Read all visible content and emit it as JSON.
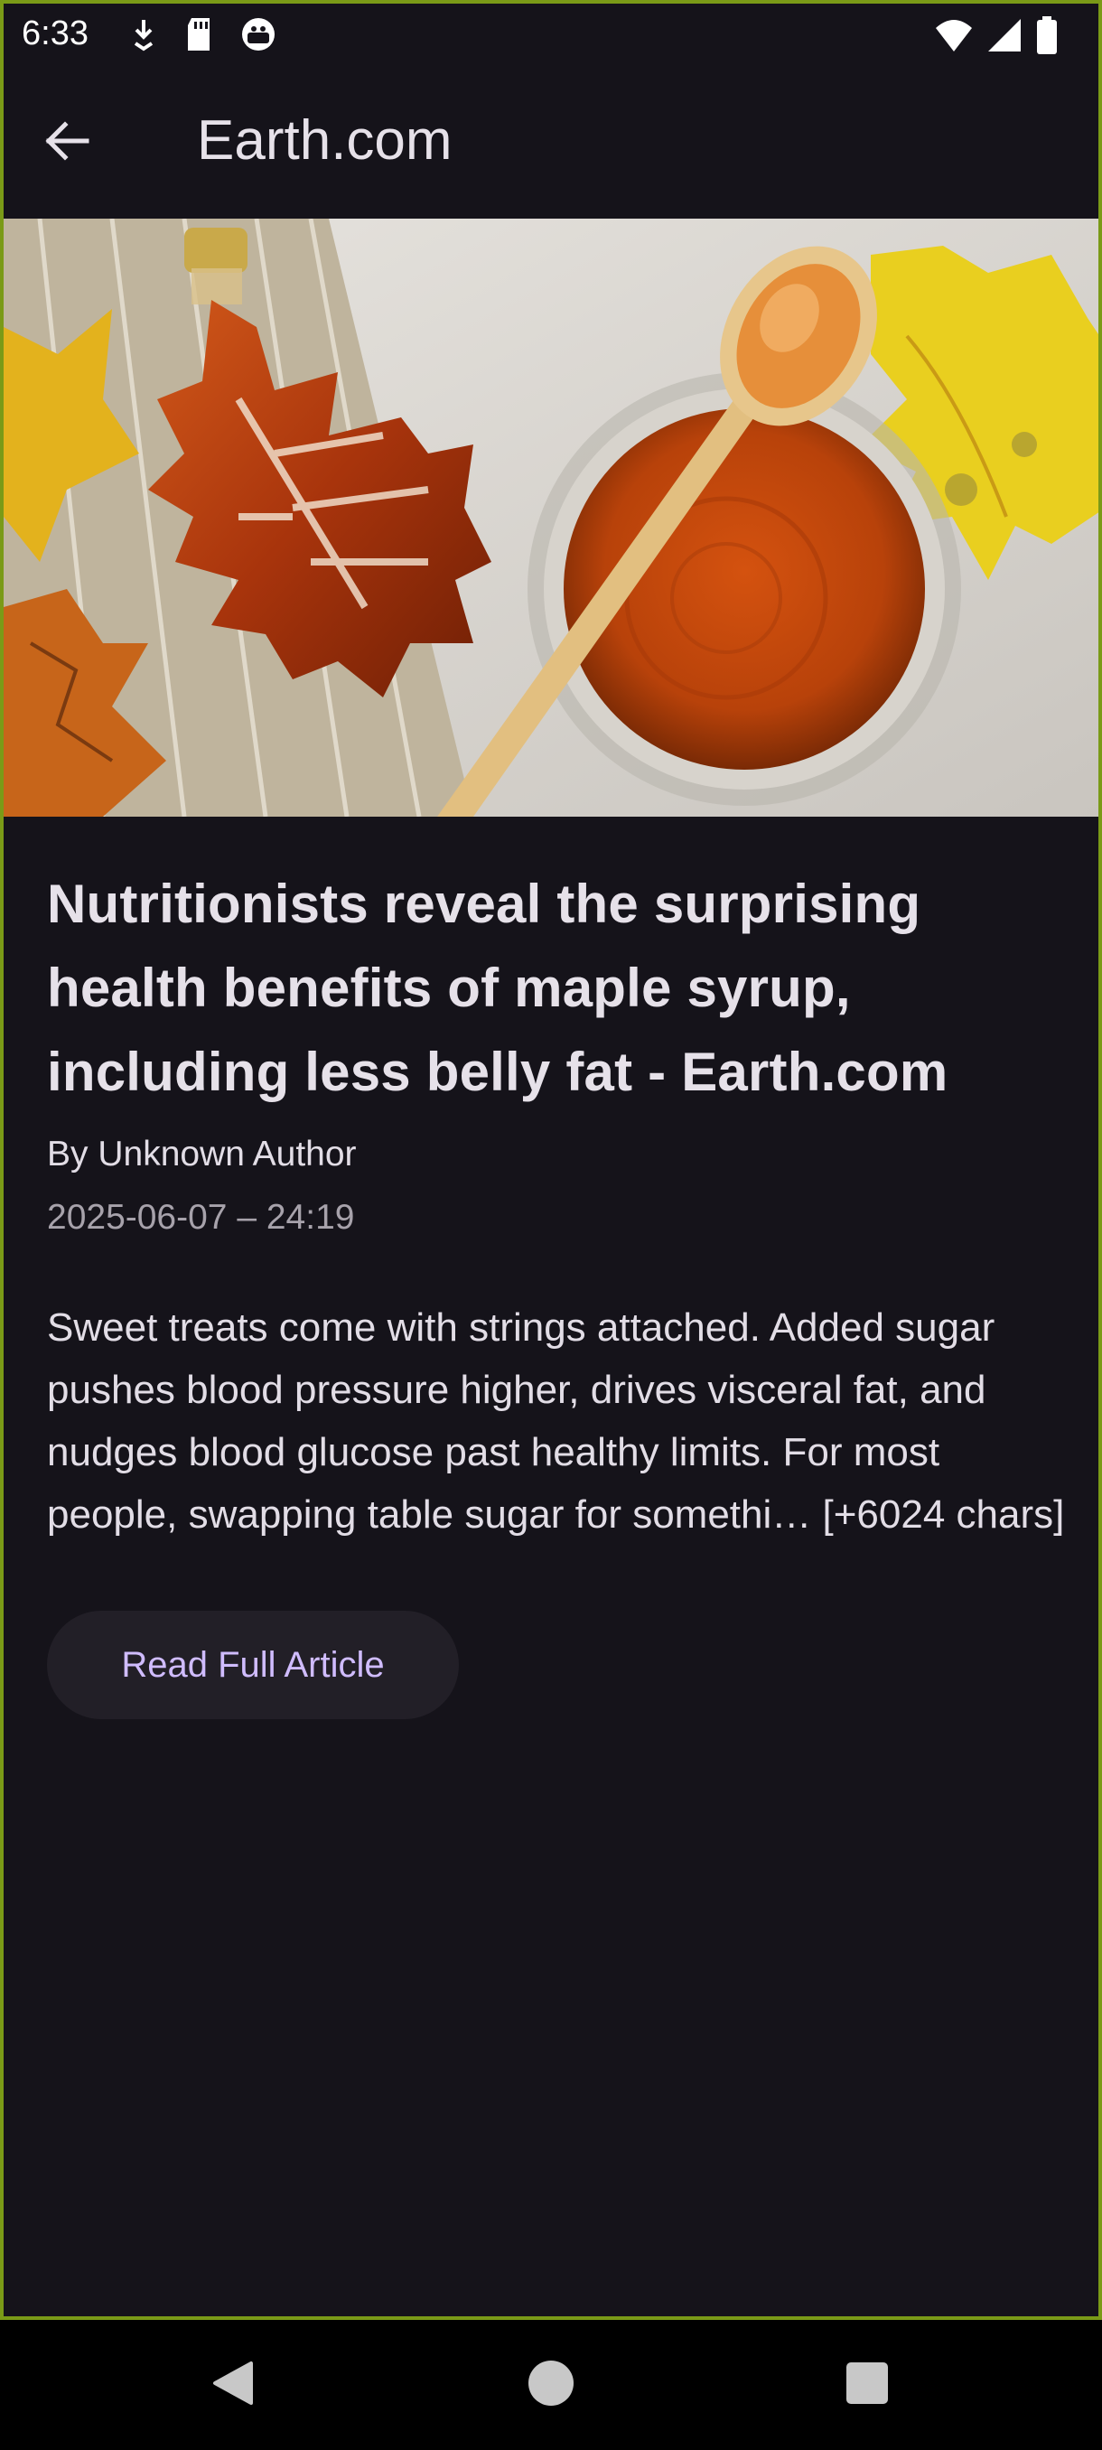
{
  "status_bar": {
    "time": "6:33",
    "left_icons": [
      "download-icon",
      "sd-card-icon",
      "android-debug-icon"
    ],
    "right_icons": [
      "wifi-icon",
      "cell-signal-icon",
      "battery-icon"
    ]
  },
  "app_bar": {
    "title": "Earth.com",
    "back_icon": "arrow-back-icon"
  },
  "hero_image": {
    "subject": "maple syrup bottle, bowl and wooden spoon with autumn leaves"
  },
  "article": {
    "headline": "Nutritionists reveal the surprising health benefits of maple syrup, including less belly fat - Earth.com",
    "byline": "By Unknown Author",
    "date": "2025-06-07 – 24:19",
    "summary": "Sweet treats come with strings attached. Added sugar pushes blood pressure higher, drives visceral fat, and nudges blood glucose past healthy limits. For most people, swapping table sugar for somethi… [+6024 chars]",
    "read_button_label": "Read Full Article"
  },
  "nav_bar": {
    "buttons": [
      "back-triangle-icon",
      "home-circle-icon",
      "recents-square-icon"
    ]
  },
  "colors": {
    "background": "#15131a",
    "accent": "#d0bcff",
    "frame_border": "#7a9a17",
    "button_bg": "#221f27"
  }
}
